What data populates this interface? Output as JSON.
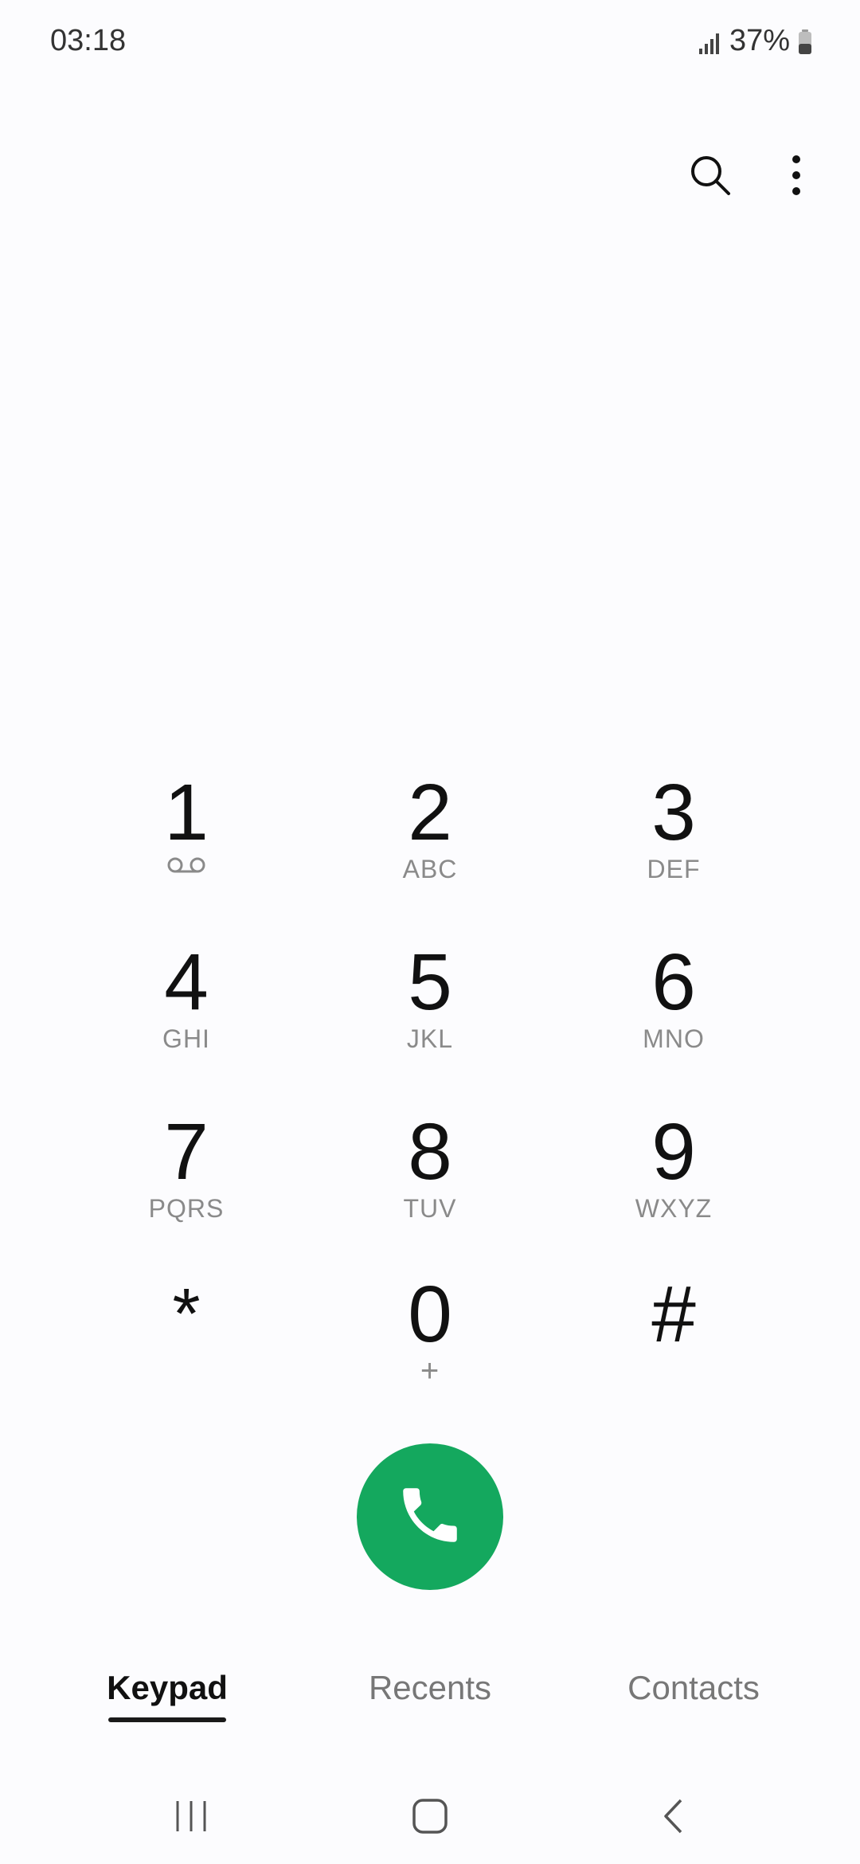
{
  "status_bar": {
    "time": "03:18",
    "battery": "37%",
    "icons": [
      "signal-icon",
      "battery-icon"
    ]
  },
  "top_actions": {
    "icons": [
      "search-icon",
      "more-options-icon"
    ]
  },
  "keypad": {
    "keys": [
      {
        "digit": "1",
        "sub": "",
        "sub_icon": "voicemail-icon"
      },
      {
        "digit": "2",
        "sub": "ABC"
      },
      {
        "digit": "3",
        "sub": "DEF"
      },
      {
        "digit": "4",
        "sub": "GHI"
      },
      {
        "digit": "5",
        "sub": "JKL"
      },
      {
        "digit": "6",
        "sub": "MNO"
      },
      {
        "digit": "7",
        "sub": "PQRS"
      },
      {
        "digit": "8",
        "sub": "TUV"
      },
      {
        "digit": "9",
        "sub": "WXYZ"
      },
      {
        "digit": "*",
        "sub": ""
      },
      {
        "digit": "0",
        "sub": "+"
      },
      {
        "digit": "#",
        "sub": ""
      }
    ]
  },
  "call_button": {
    "icon": "phone-icon",
    "color": "#14A85E"
  },
  "tabs": [
    {
      "label": "Keypad",
      "active": true
    },
    {
      "label": "Recents",
      "active": false
    },
    {
      "label": "Contacts",
      "active": false
    }
  ],
  "nav_bar": {
    "icons": [
      "recent-apps-icon",
      "home-icon",
      "back-icon"
    ]
  }
}
